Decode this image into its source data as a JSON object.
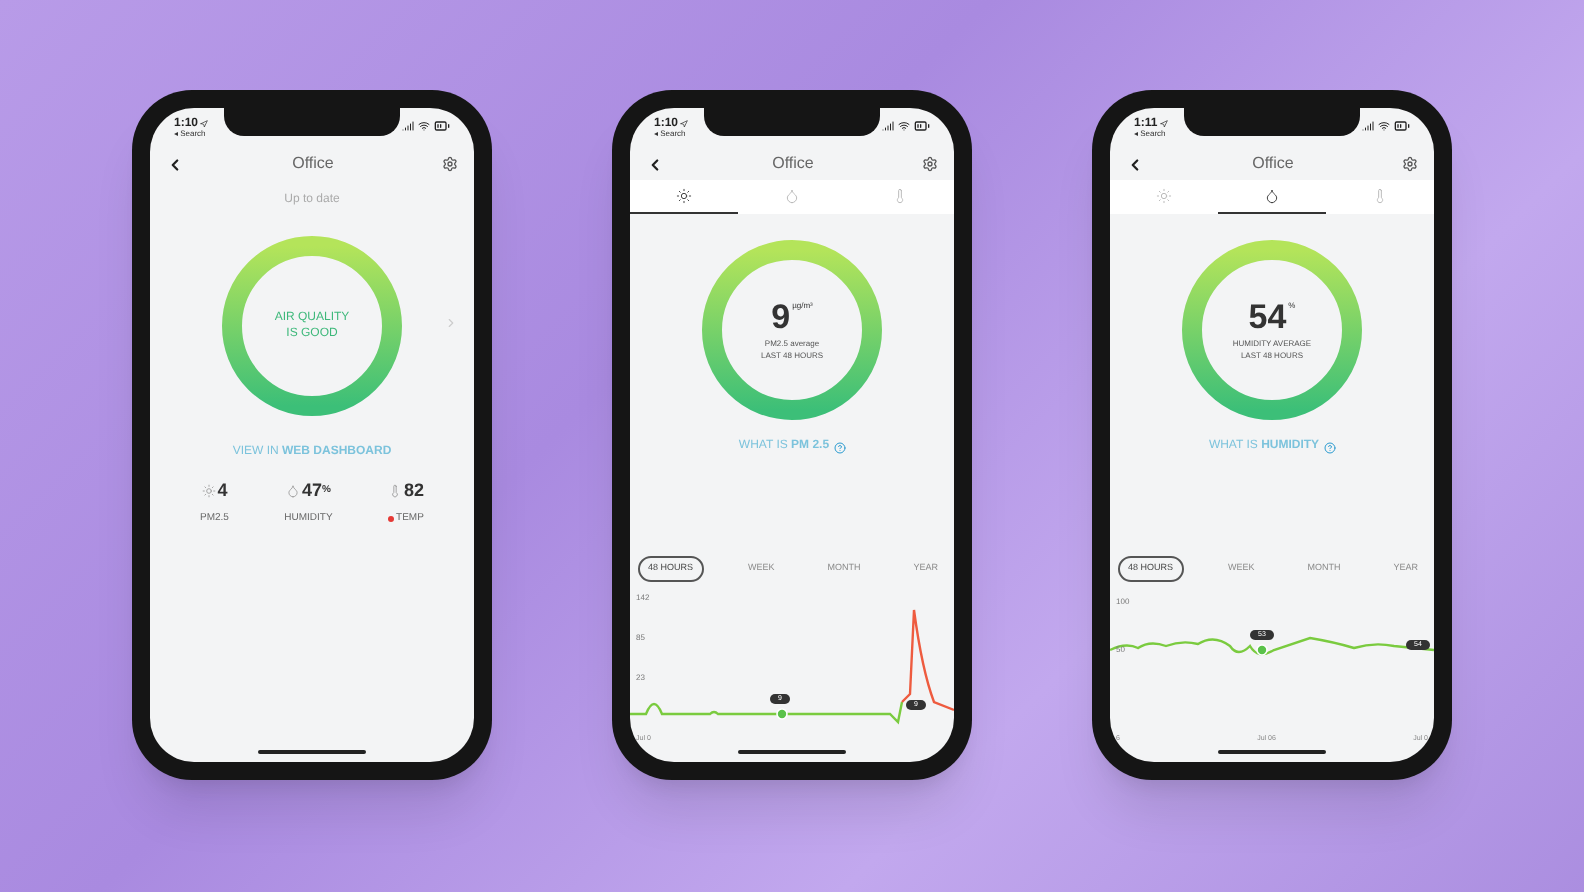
{
  "phones": [
    {
      "kind": "summary",
      "time": "1:10",
      "back_app": "◂ Search",
      "title": "Office",
      "status": "Up to date",
      "ring_text": "AIR QUALITY IS GOOD",
      "link": "VIEW IN **WEB DASHBOARD**",
      "stats": [
        {
          "kind": "pm",
          "value": "4",
          "label": "PM2.5",
          "alert": false
        },
        {
          "kind": "humidity",
          "value": "47",
          "unit": "%",
          "label": "HUMIDITY",
          "alert": false
        },
        {
          "kind": "temp",
          "value": "82",
          "label": "TEMP",
          "alert": true
        }
      ]
    },
    {
      "kind": "detail",
      "time": "1:10",
      "back_app": "◂ Search",
      "title": "Office",
      "tabs": [
        {
          "kind": "pm",
          "selected": true
        },
        {
          "kind": "humidity",
          "selected": false
        },
        {
          "kind": "temp",
          "selected": false
        }
      ],
      "value": "9",
      "unit": "µg/m³",
      "caption": "PM2.5 average",
      "caption2": "LAST 48 HOURS",
      "link": "WHAT IS **PM 2.5**",
      "ranges": [
        {
          "label": "48 HOURS",
          "selected": true
        },
        {
          "label": "WEEK",
          "selected": false
        },
        {
          "label": "MONTH",
          "selected": false
        },
        {
          "label": "YEAR",
          "selected": false
        }
      ],
      "y_labels": [
        "142",
        "85",
        "23"
      ],
      "x_labels": [
        "Jul 0"
      ],
      "pills": [
        "9",
        "9"
      ]
    },
    {
      "kind": "detail",
      "time": "1:11",
      "back_app": "◂ Search",
      "title": "Office",
      "tabs": [
        {
          "kind": "pm",
          "selected": false
        },
        {
          "kind": "humidity",
          "selected": true
        },
        {
          "kind": "temp",
          "selected": false
        }
      ],
      "value": "54",
      "unit": "%",
      "caption": "HUMIDITY AVERAGE",
      "caption2": "LAST 48 HOURS",
      "link": "WHAT IS **HUMIDITY**",
      "ranges": [
        {
          "label": "48 HOURS",
          "selected": true
        },
        {
          "label": "WEEK",
          "selected": false
        },
        {
          "label": "MONTH",
          "selected": false
        },
        {
          "label": "YEAR",
          "selected": false
        }
      ],
      "y_labels": [
        "100",
        "50"
      ],
      "x_labels": [
        "6",
        "Jul 06",
        "Jul 0"
      ],
      "pills": [
        "53",
        "54"
      ]
    }
  ]
}
